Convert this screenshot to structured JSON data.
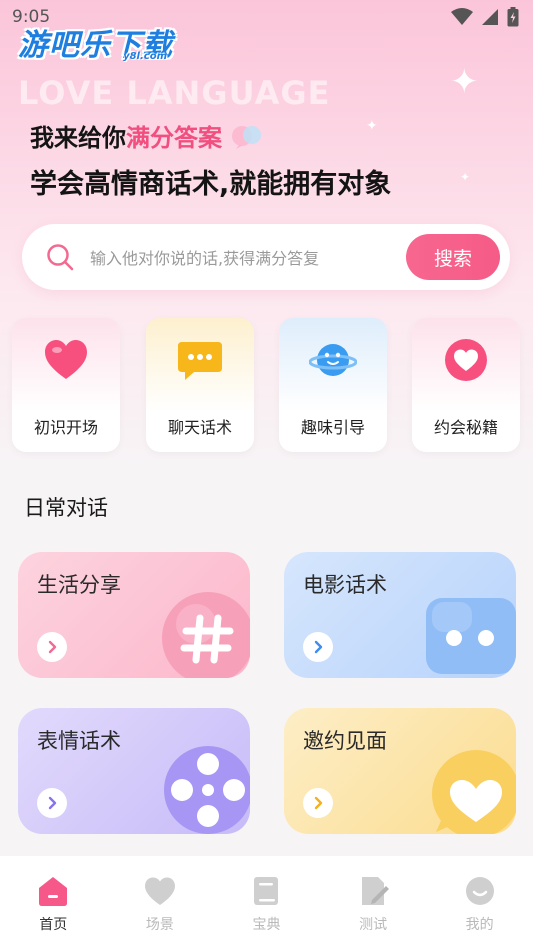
{
  "status_bar": {
    "time": "9:05"
  },
  "watermark": {
    "brand": "游吧乐下载",
    "domain": "y8l.com"
  },
  "hero": {
    "bg_text": "LOVE LANGUAGE",
    "line1_prefix": "我来给你",
    "line1_highlight": "满分答案",
    "line2": "学会高情商话术,就能拥有对象"
  },
  "search": {
    "placeholder": "输入他对你说的话,获得满分答复",
    "button_label": "搜索"
  },
  "categories": [
    {
      "label": "初识开场",
      "icon": "heart-icon",
      "color": "#fde4ec"
    },
    {
      "label": "聊天话术",
      "icon": "chat-bubble-icon",
      "color": "#fdf1d2"
    },
    {
      "label": "趣味引导",
      "icon": "planet-icon",
      "color": "#e0eefc"
    },
    {
      "label": "约会秘籍",
      "icon": "heart-circle-icon",
      "color": "#fde4ec"
    }
  ],
  "section": {
    "title": "日常对话"
  },
  "cards": [
    {
      "title": "生活分享",
      "icon": "hashtag-icon"
    },
    {
      "title": "电影话术",
      "icon": "chat-dots-icon"
    },
    {
      "title": "表情话术",
      "icon": "film-reel-icon"
    },
    {
      "title": "邀约见面",
      "icon": "heart-bubble-icon"
    }
  ],
  "tabs": [
    {
      "label": "首页",
      "icon": "home-icon",
      "active": true
    },
    {
      "label": "场景",
      "icon": "heart-icon",
      "active": false
    },
    {
      "label": "宝典",
      "icon": "book-icon",
      "active": false
    },
    {
      "label": "测试",
      "icon": "edit-doc-icon",
      "active": false
    },
    {
      "label": "我的",
      "icon": "smiley-icon",
      "active": false
    }
  ],
  "colors": {
    "accent": "#f55b87",
    "highlight_text": "#f04f7f",
    "watermark_blue": "#1e7fe0"
  }
}
